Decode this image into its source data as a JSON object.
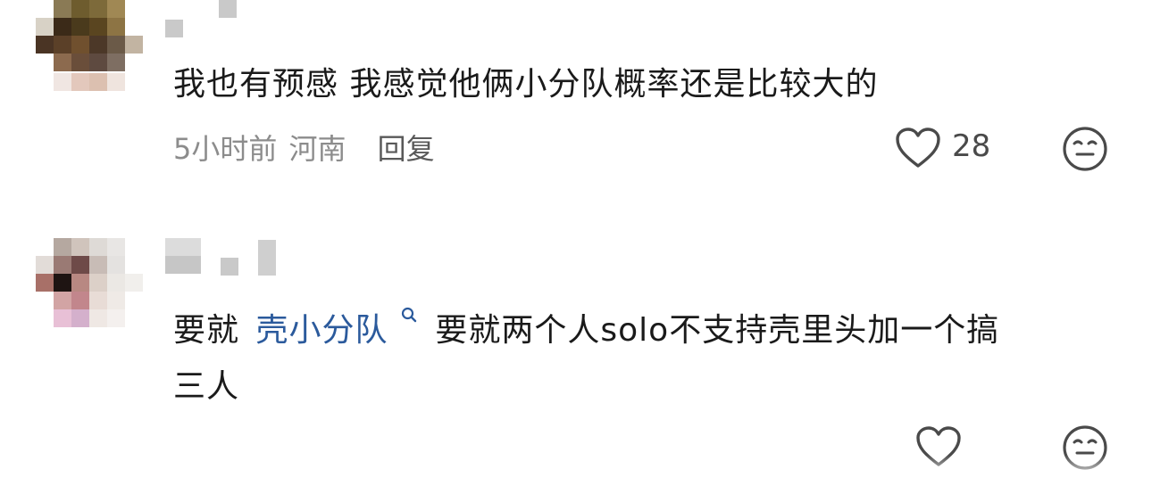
{
  "comments": [
    {
      "text": "我也有预感 我感觉他俩小分队概率还是比较大的",
      "time": "5小时前",
      "location": "河南",
      "reply_label": "回复",
      "likes": "28",
      "like_icon": "heart-outline-icon",
      "emoji_icon": "meh-face-icon"
    },
    {
      "text_before": "要就",
      "link_text": "壳小分队",
      "link_icon": "search-icon",
      "text_after": "要就两个人solo不支持壳里头加一个搞",
      "text_line2": "三人",
      "like_icon": "heart-outline-icon",
      "emoji_icon": "meh-face-icon"
    }
  ],
  "colors": {
    "link": "#2b5a9c",
    "meta": "#8c8c8c",
    "text": "#1a1a1a"
  }
}
